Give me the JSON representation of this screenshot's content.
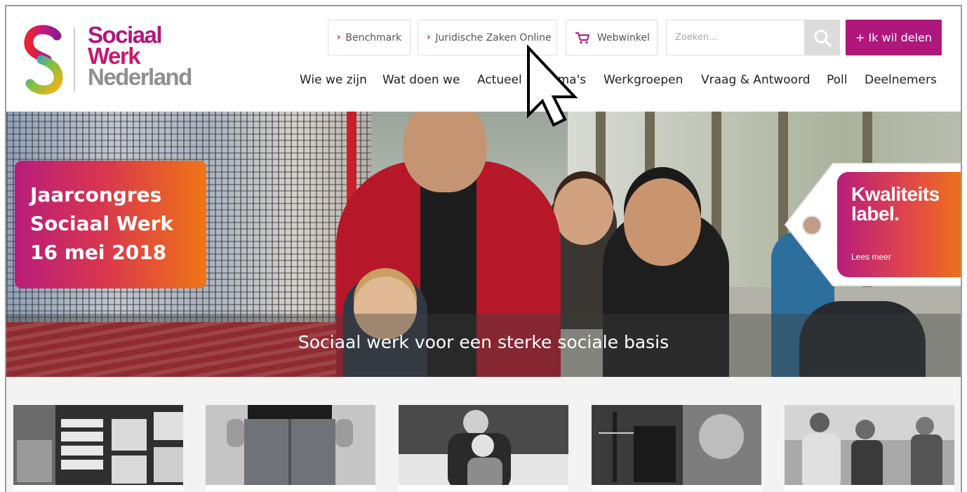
{
  "brand": {
    "logo_lines": [
      "Sociaal",
      "Werk",
      "Nederland"
    ],
    "colors": {
      "accent": "#b0177c",
      "orange": "#f07515",
      "grey": "#8f8f8f"
    }
  },
  "topbar": {
    "benchmark": "Benchmark",
    "juridische": "Juridische Zaken Online",
    "webwinkel": "Webwinkel",
    "search_placeholder": "Zoeken...",
    "share": "+ Ik wil delen"
  },
  "nav": {
    "items": [
      "Wie we zijn",
      "Wat doen we",
      "Actueel",
      "Thema's",
      "Werkgroepen",
      "Vraag & Antwoord",
      "Poll",
      "Deelnemers"
    ]
  },
  "hero": {
    "congres_lines": [
      "Jaarcongres",
      "Sociaal Werk",
      "16 mei 2018"
    ],
    "tagline": "Sociaal werk voor een sterke sociale basis",
    "label_title_1": "Kwaliteits",
    "label_title_2": "label.",
    "label_link": "Lees meer"
  },
  "icons": {
    "chevron": "chevron-right-icon",
    "cart": "cart-icon",
    "search": "search-icon",
    "cursor": "mouse-pointer-icon"
  }
}
